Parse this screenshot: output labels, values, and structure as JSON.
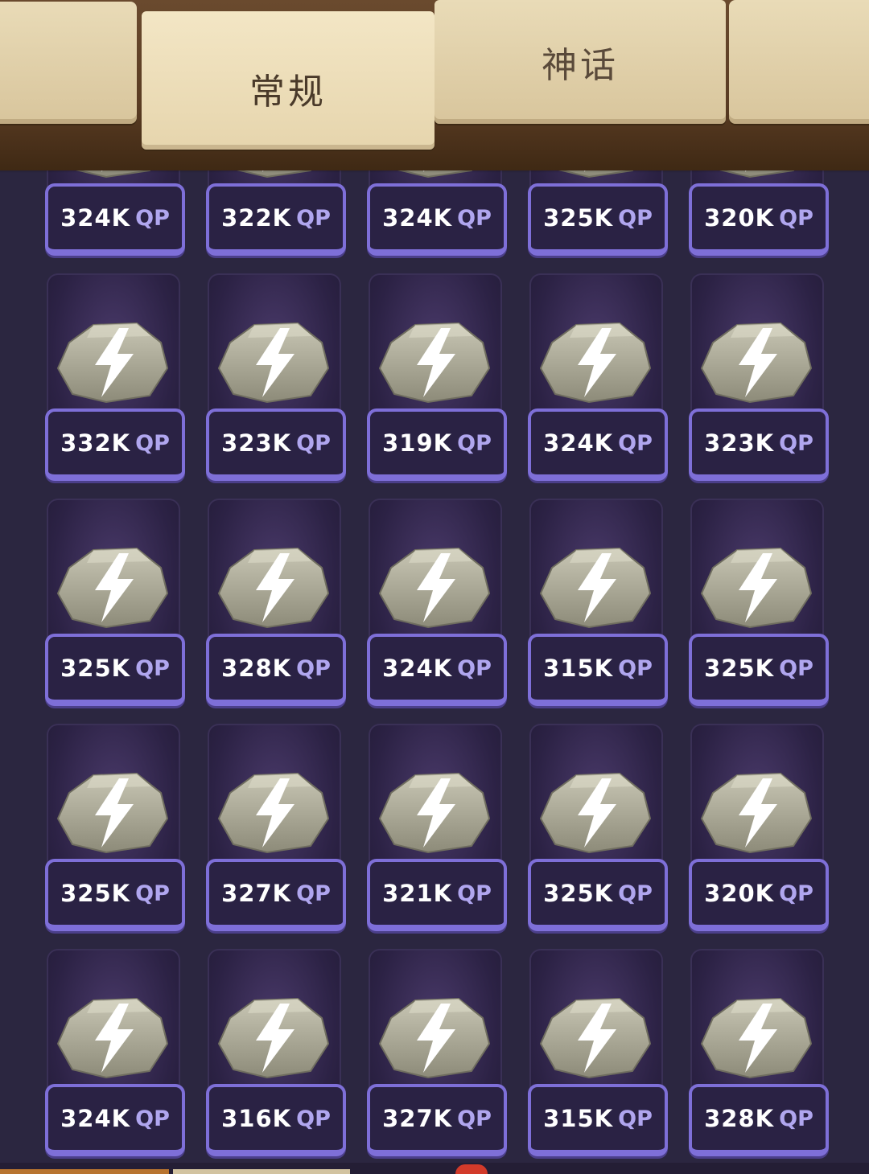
{
  "tabs": [
    {
      "label": ""
    },
    {
      "label": "常规",
      "active": true
    },
    {
      "label": "神话"
    },
    {
      "label": ""
    }
  ],
  "currency_unit": "QP",
  "item_icon": "gray-stone-lightning-icon",
  "rows": [
    [
      "324K",
      "322K",
      "324K",
      "325K",
      "320K"
    ],
    [
      "332K",
      "323K",
      "319K",
      "324K",
      "323K"
    ],
    [
      "325K",
      "328K",
      "324K",
      "315K",
      "325K"
    ],
    [
      "325K",
      "327K",
      "321K",
      "325K",
      "320K"
    ],
    [
      "324K",
      "316K",
      "327K",
      "315K",
      "328K"
    ]
  ],
  "colors": {
    "background": "#2b2640",
    "card_border": "#7e6fd8",
    "tab_active": "#e6d5ad",
    "tab_text": "#4a3a2a"
  }
}
